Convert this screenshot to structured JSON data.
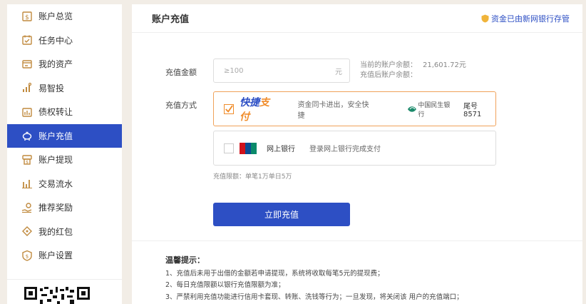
{
  "sidebar": {
    "items": [
      {
        "label": "账户总览",
        "icon": "account-overview-icon",
        "active": false
      },
      {
        "label": "任务中心",
        "icon": "task-center-icon",
        "active": false
      },
      {
        "label": "我的资产",
        "icon": "assets-icon",
        "active": false
      },
      {
        "label": "易智投",
        "icon": "invest-icon",
        "active": false
      },
      {
        "label": "债权转让",
        "icon": "debt-transfer-icon",
        "active": false
      },
      {
        "label": "账户充值",
        "icon": "piggy-bank-icon",
        "active": true
      },
      {
        "label": "账户提现",
        "icon": "withdraw-icon",
        "active": false
      },
      {
        "label": "交易流水",
        "icon": "transactions-icon",
        "active": false
      },
      {
        "label": "推荐奖励",
        "icon": "referral-reward-icon",
        "active": false
      },
      {
        "label": "我的红包",
        "icon": "red-packet-icon",
        "active": false
      },
      {
        "label": "账户设置",
        "icon": "account-settings-icon",
        "active": false
      }
    ]
  },
  "main": {
    "title": "账户充值",
    "depository": "资金已由新网银行存管",
    "amount": {
      "label": "充值金额",
      "placeholder": "≥100",
      "unit": "元",
      "balance_label": "当前的账户余额：",
      "balance_value": "21,601.72元",
      "after_label": "充值后账户余额："
    },
    "method": {
      "label": "充值方式",
      "quick": {
        "logo_a": "快捷",
        "logo_b": "支付",
        "desc": "资金同卡进出，安全快捷",
        "bank": "中国民生银行",
        "tail": "尾号8571"
      },
      "online": {
        "logo": "UnionPay 银联",
        "label": "网上银行",
        "desc": "登录网上银行完成支付"
      }
    },
    "limit": "充值限额：单笔1万单日5万",
    "submit": "立即充值",
    "tips": {
      "title": "温馨提示：",
      "lines": [
        "1、充值后未用于出借的金额若申请提现，系统将收取每笔5元的提现费；",
        "2、每日充值限额以银行充值限额为准；",
        "3、严禁利用充值功能进行信用卡套现、转账、洗钱等行为；一旦发现，将关闭该 用户的充值端口；"
      ]
    }
  },
  "colors": {
    "accent": "#2d4fc4",
    "gold": "#c08a3e",
    "orange": "#f08c2a",
    "background": "#f2ede6"
  }
}
